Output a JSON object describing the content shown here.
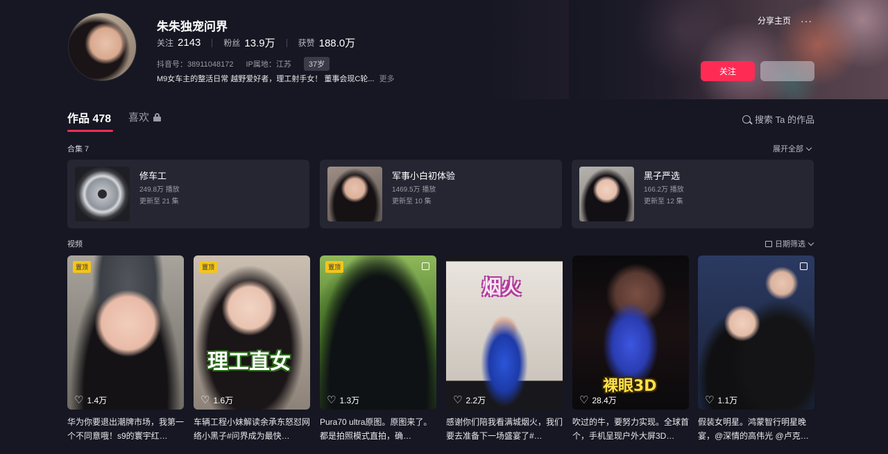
{
  "profile": {
    "name": "朱朱独宠问界",
    "following_label": "关注",
    "following": "2143",
    "followers_label": "粉丝",
    "followers": "13.9万",
    "likes_label": "获赞",
    "likes": "188.0万",
    "douyin_id": "抖音号：38911048172",
    "ip_location": "IP属地：江苏",
    "age": "37岁",
    "bio": "M9女车主的整活日常 越野爱好者，理工射手女！ 董事会现C轮...",
    "bio_more": "更多"
  },
  "header": {
    "share_label": "分享主页",
    "more_dots": "···",
    "follow_button": "关注"
  },
  "tabs": {
    "works": "作品 478",
    "likes": "喜欢",
    "search": "搜索 Ta 的作品"
  },
  "collections": {
    "label": "合集 7",
    "expand_label": "展开全部",
    "items": [
      {
        "title": "修车工",
        "plays": "249.8万 播放",
        "update": "更新至 21 集"
      },
      {
        "title": "军事小白初体验",
        "plays": "1469.5万 播放",
        "update": "更新至 10 集"
      },
      {
        "title": "黑子严选",
        "plays": "166.2万 播放",
        "update": "更新至 12 集"
      }
    ]
  },
  "videos": {
    "label": "视频",
    "date_filter": "日期筛选",
    "pin_label": "置顶",
    "items": [
      {
        "likes": "1.4万",
        "title": "华为你要退出潮牌市场，我第一个不同意哦！s9的寰宇红…",
        "pinned": true,
        "overlay": ""
      },
      {
        "likes": "1.6万",
        "title": "车辆工程小妹解读余承东怒怼网络小黑子#问界成为最快…",
        "pinned": true,
        "overlay": "理工直女"
      },
      {
        "likes": "1.3万",
        "title": "Pura70 ultra原图。原图来了。都是拍照模式直拍，确…",
        "pinned": true,
        "overlay": ""
      },
      {
        "likes": "2.2万",
        "title": "感谢你们陪我看满城烟火，我们要去准备下一场盛宴了#…",
        "pinned": false,
        "overlay": "烟火"
      },
      {
        "likes": "28.4万",
        "title": "吹过的牛，要努力实现。全球首个，手机呈现户外大屏3D…",
        "pinned": false,
        "overlay": "裸眼3D"
      },
      {
        "likes": "1.1万",
        "title": "假装女明星。鸿蒙智行明星晚宴，@深情的高伟光 @卢克…",
        "pinned": false,
        "overlay": ""
      }
    ]
  },
  "colors": {
    "accent": "#fe2c55",
    "background": "#161722",
    "card": "#252632",
    "pin": "#f5c518"
  }
}
